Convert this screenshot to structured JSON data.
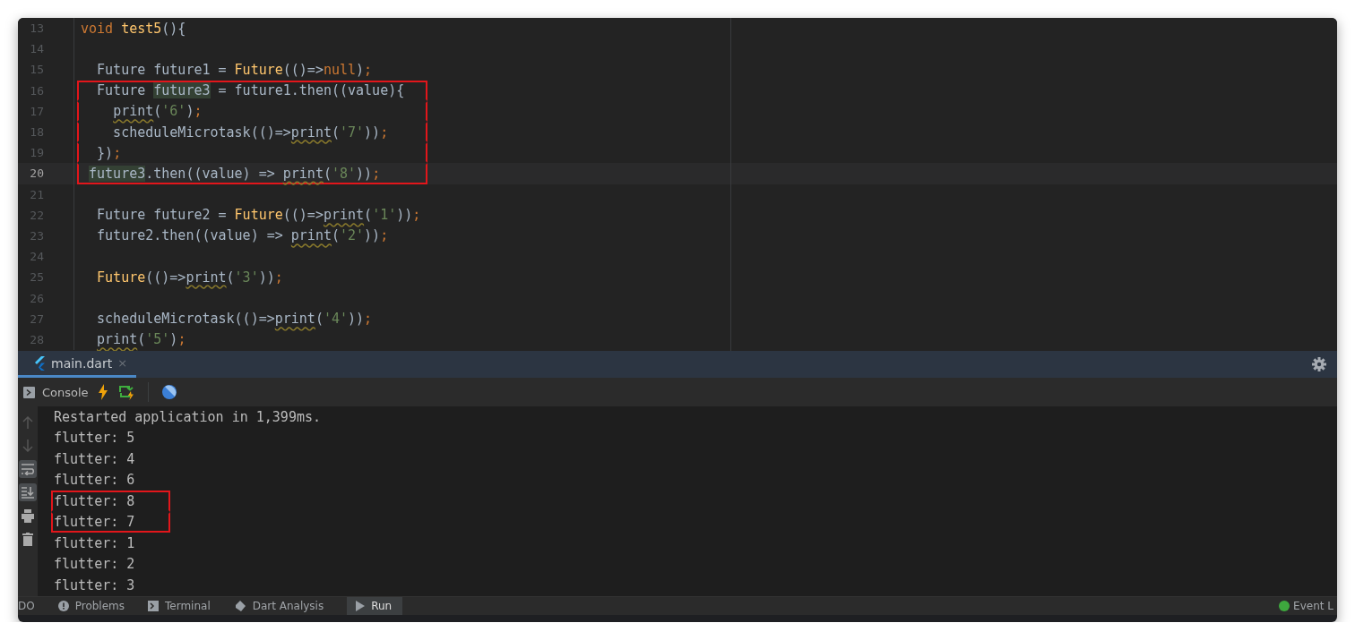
{
  "editor": {
    "lines": [
      {
        "number": "13",
        "current": false,
        "boxed": false,
        "segments": [
          {
            "text": "void ",
            "kind": "keyword"
          },
          {
            "text": "test5",
            "kind": "call"
          },
          {
            "text": "(){",
            "kind": "plain"
          }
        ]
      },
      {
        "number": "14",
        "current": false
      },
      {
        "number": "15",
        "current": false,
        "boxed": false,
        "segments": [
          {
            "text": "  Future future1 = ",
            "kind": "plain"
          },
          {
            "text": "Future",
            "kind": "call"
          },
          {
            "text": "(()=>",
            "kind": "plain"
          },
          {
            "text": "null",
            "kind": "keyword"
          },
          {
            "text": ")",
            "kind": "plain"
          },
          {
            "text": ";",
            "kind": "keyword"
          }
        ]
      },
      {
        "number": "16",
        "current": false,
        "boxed": true,
        "segments": [
          {
            "text": "  Future ",
            "kind": "plain"
          },
          {
            "text": "future3",
            "kind": "ref"
          },
          {
            "text": " = future1.then((value){",
            "kind": "plain"
          }
        ]
      },
      {
        "number": "17",
        "current": false,
        "boxed": true,
        "segments": [
          {
            "text": "    print",
            "kind": "warn"
          },
          {
            "text": "(",
            "kind": "plain"
          },
          {
            "text": "'6'",
            "kind": "string"
          },
          {
            "text": ")",
            "kind": "plain"
          },
          {
            "text": ";",
            "kind": "keyword"
          }
        ]
      },
      {
        "number": "18",
        "current": false,
        "boxed": true,
        "segments": [
          {
            "text": "    scheduleMicrotask(()=>",
            "kind": "plain"
          },
          {
            "text": "print",
            "kind": "warn"
          },
          {
            "text": "(",
            "kind": "plain"
          },
          {
            "text": "'7'",
            "kind": "string"
          },
          {
            "text": "))",
            "kind": "plain"
          },
          {
            "text": ";",
            "kind": "keyword"
          }
        ]
      },
      {
        "number": "19",
        "current": false,
        "boxed": true,
        "segments": [
          {
            "text": "  })",
            "kind": "plain"
          },
          {
            "text": ";",
            "kind": "keyword"
          }
        ]
      },
      {
        "number": "20",
        "current": true,
        "boxed": true,
        "segments": [
          {
            "text": " future3",
            "kind": "ref"
          },
          {
            "text": ".then((value) => ",
            "kind": "plain"
          },
          {
            "text": "print",
            "kind": "warn"
          },
          {
            "text": "(",
            "kind": "plain"
          },
          {
            "text": "'8'",
            "kind": "string"
          },
          {
            "text": "))",
            "kind": "plain"
          },
          {
            "text": ";",
            "kind": "keyword"
          }
        ]
      },
      {
        "number": "21",
        "current": false
      },
      {
        "number": "22",
        "current": false,
        "boxed": false,
        "segments": [
          {
            "text": "  Future future2 = ",
            "kind": "plain"
          },
          {
            "text": "Future",
            "kind": "call"
          },
          {
            "text": "(()=>",
            "kind": "plain"
          },
          {
            "text": "print",
            "kind": "warn"
          },
          {
            "text": "(",
            "kind": "plain"
          },
          {
            "text": "'1'",
            "kind": "string"
          },
          {
            "text": "))",
            "kind": "plain"
          },
          {
            "text": ";",
            "kind": "keyword"
          }
        ]
      },
      {
        "number": "23",
        "current": false,
        "boxed": false,
        "segments": [
          {
            "text": "  future2.then((value) => ",
            "kind": "plain"
          },
          {
            "text": "print",
            "kind": "warn"
          },
          {
            "text": "(",
            "kind": "plain"
          },
          {
            "text": "'2'",
            "kind": "string"
          },
          {
            "text": "))",
            "kind": "plain"
          },
          {
            "text": ";",
            "kind": "keyword"
          }
        ]
      },
      {
        "number": "24",
        "current": false
      },
      {
        "number": "25",
        "current": false,
        "boxed": false,
        "segments": [
          {
            "text": "  Future",
            "kind": "call"
          },
          {
            "text": "(()=>",
            "kind": "plain"
          },
          {
            "text": "print",
            "kind": "warn"
          },
          {
            "text": "(",
            "kind": "plain"
          },
          {
            "text": "'3'",
            "kind": "string"
          },
          {
            "text": "))",
            "kind": "plain"
          },
          {
            "text": ";",
            "kind": "keyword"
          }
        ]
      },
      {
        "number": "26",
        "current": false
      },
      {
        "number": "27",
        "current": false,
        "boxed": false,
        "segments": [
          {
            "text": "  scheduleMicrotask(()=>",
            "kind": "plain"
          },
          {
            "text": "print",
            "kind": "warn"
          },
          {
            "text": "(",
            "kind": "plain"
          },
          {
            "text": "'4'",
            "kind": "string"
          },
          {
            "text": "))",
            "kind": "plain"
          },
          {
            "text": ";",
            "kind": "keyword"
          }
        ]
      },
      {
        "number": "28",
        "current": false,
        "boxed": false,
        "segments": [
          {
            "text": "  print",
            "kind": "warn"
          },
          {
            "text": "(",
            "kind": "plain"
          },
          {
            "text": "'5'",
            "kind": "string"
          },
          {
            "text": ")",
            "kind": "plain"
          },
          {
            "text": ";",
            "kind": "keyword"
          }
        ]
      }
    ]
  },
  "run_panel": {
    "tabs": [
      {
        "label": "main.dart",
        "close": "×",
        "selected": true
      }
    ],
    "toolbar": [
      {
        "kind": "console",
        "label": "Console"
      },
      {
        "kind": "hot-reload"
      },
      {
        "kind": "hot-restart"
      },
      {
        "kind": "devtools"
      }
    ],
    "side_tools": [
      {
        "kind": "up",
        "active": false
      },
      {
        "kind": "down",
        "active": false
      },
      {
        "kind": "wrap",
        "active": true
      },
      {
        "kind": "scroll-end",
        "active": true
      },
      {
        "kind": "print",
        "active": false
      },
      {
        "kind": "trash",
        "active": false
      }
    ],
    "output": [
      {
        "text": "Restarted application in 1,399ms.",
        "boxed": false
      },
      {
        "text": "flutter: 5",
        "boxed": false
      },
      {
        "text": "flutter: 4",
        "boxed": false
      },
      {
        "text": "flutter: 6",
        "boxed": false
      },
      {
        "text": "flutter: 8",
        "boxed": true
      },
      {
        "text": "flutter: 7",
        "boxed": true
      },
      {
        "text": "flutter: 1",
        "boxed": false
      },
      {
        "text": "flutter: 2",
        "boxed": false
      },
      {
        "text": "flutter: 3",
        "boxed": false
      }
    ]
  },
  "bottom_bar": {
    "items": [
      {
        "label": "DO",
        "kind": "none",
        "selected": false
      },
      {
        "label": "Problems",
        "kind": "problems",
        "selected": false
      },
      {
        "label": "Terminal",
        "kind": "terminal",
        "selected": false
      },
      {
        "label": "Dart Analysis",
        "kind": "analysis",
        "selected": false
      },
      {
        "label": "Run",
        "kind": "run",
        "selected": true
      }
    ],
    "event_log": {
      "label": "Event L"
    }
  }
}
